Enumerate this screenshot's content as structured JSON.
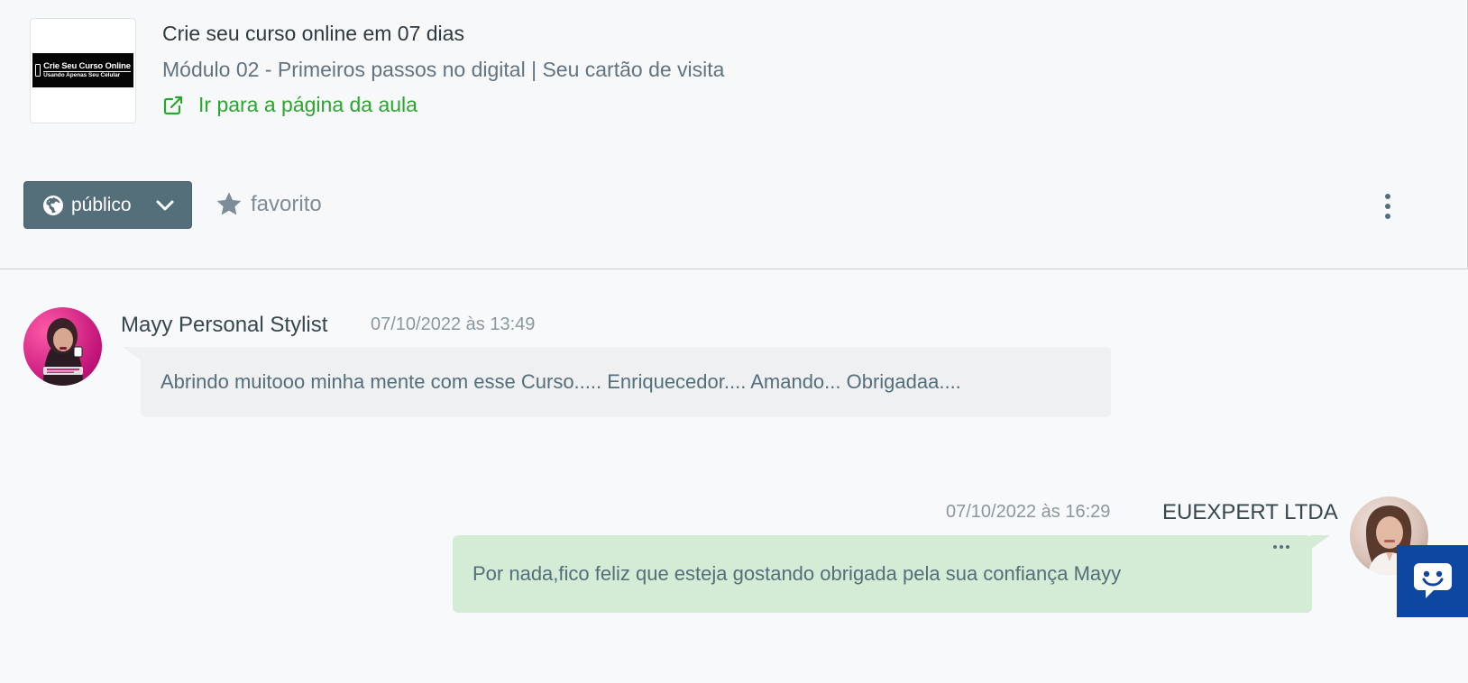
{
  "lesson": {
    "thumbnail": {
      "line1": "Crie Seu Curso Online",
      "line2": "Usando Apenas Seu Celular"
    },
    "course_title": "Crie seu curso online em 07 dias",
    "module_title": "Módulo 02 - Primeiros passos no digital | Seu cartão de visita",
    "link_label": "Ir para a página da aula",
    "link_icon": "external-link-icon"
  },
  "actions": {
    "visibility_label": "público",
    "visibility_icon": "globe-icon",
    "favorite_label": "favorito",
    "favorite_icon": "star-icon",
    "more_icon": "more-vertical-icon"
  },
  "comments": [
    {
      "author": "Mayy Personal Stylist",
      "timestamp": "07/10/2022 às 13:49",
      "text": "Abrindo muitooo minha mente com esse Curso..... Enriquecedor.... Amando... Obrigadaa....",
      "bubble_color": "#eef0f2"
    },
    {
      "author": "EUEXPERT LTDA",
      "timestamp": "07/10/2022 às 16:29",
      "text": "Por nada,fico feliz que esteja gostando obrigada pela sua confiança Mayy",
      "bubble_color": "#d4ecd6"
    }
  ],
  "chat_widget": {
    "icon": "chat-smile-icon",
    "color": "#0d47a1"
  },
  "colors": {
    "link": "#2aa62e",
    "visibility_button": "#546e7a"
  }
}
